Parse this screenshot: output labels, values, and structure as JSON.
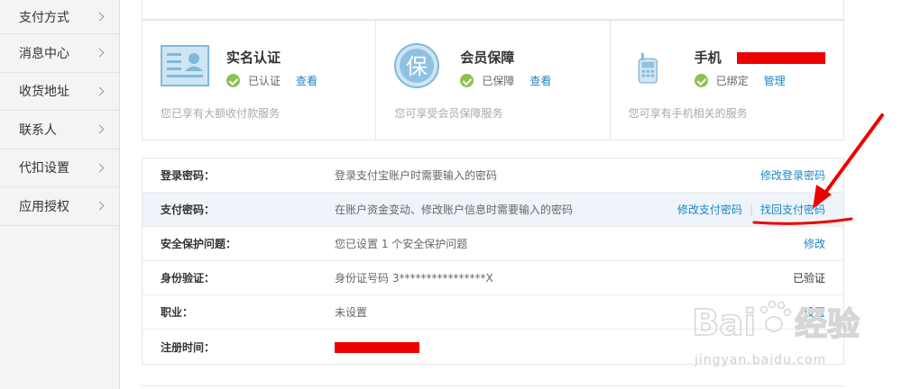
{
  "sidebar": {
    "items": [
      {
        "label": "支付方式"
      },
      {
        "label": "消息中心"
      },
      {
        "label": "收货地址"
      },
      {
        "label": "联系人"
      },
      {
        "label": "代扣设置"
      },
      {
        "label": "应用授权"
      }
    ]
  },
  "cards": [
    {
      "title": "实名认证",
      "status": "已认证",
      "action": "查看",
      "desc": "您已享有大额收付款服务",
      "icon": "id-card-icon"
    },
    {
      "title": "会员保障",
      "status": "已保障",
      "action": "查看",
      "desc": "您可享受会员保障服务",
      "icon": "shield-guarantee-icon",
      "icon_char": "保"
    },
    {
      "title": "手机",
      "status": "已绑定",
      "action": "管理",
      "desc": "您可享有手机相关的服务",
      "icon": "mobile-phone-icon"
    }
  ],
  "security": {
    "rows": [
      {
        "label": "登录密码：",
        "value": "登录支付宝账户时需要输入的密码",
        "actions": [
          "修改登录密码"
        ]
      },
      {
        "label": "支付密码：",
        "value": "在账户资金变动、修改账户信息时需要输入的密码",
        "actions": [
          "修改支付密码",
          "找回支付密码"
        ],
        "separator": "|"
      },
      {
        "label": "安全保护问题：",
        "value": "您已设置 1 个安全保护问题",
        "actions": [
          "修改"
        ]
      },
      {
        "label": "身份验证：",
        "value": "身份证号码 3****************X",
        "status": "已验证"
      },
      {
        "label": "职业：",
        "value": "未设置",
        "actions": [
          "设置"
        ]
      },
      {
        "label": "注册时间：",
        "value": ""
      }
    ]
  },
  "colors": {
    "link": "#1a86c8",
    "check": "#8cc152",
    "redaction": "#ee0000",
    "annotation": "#ee0000",
    "icon_blue": "#7fb8dc",
    "row_highlight": "#eef4f9"
  },
  "watermark": {
    "brand": "Bai",
    "paw": "du",
    "suffix": "经验",
    "url": "jingyan.baidu.com"
  }
}
